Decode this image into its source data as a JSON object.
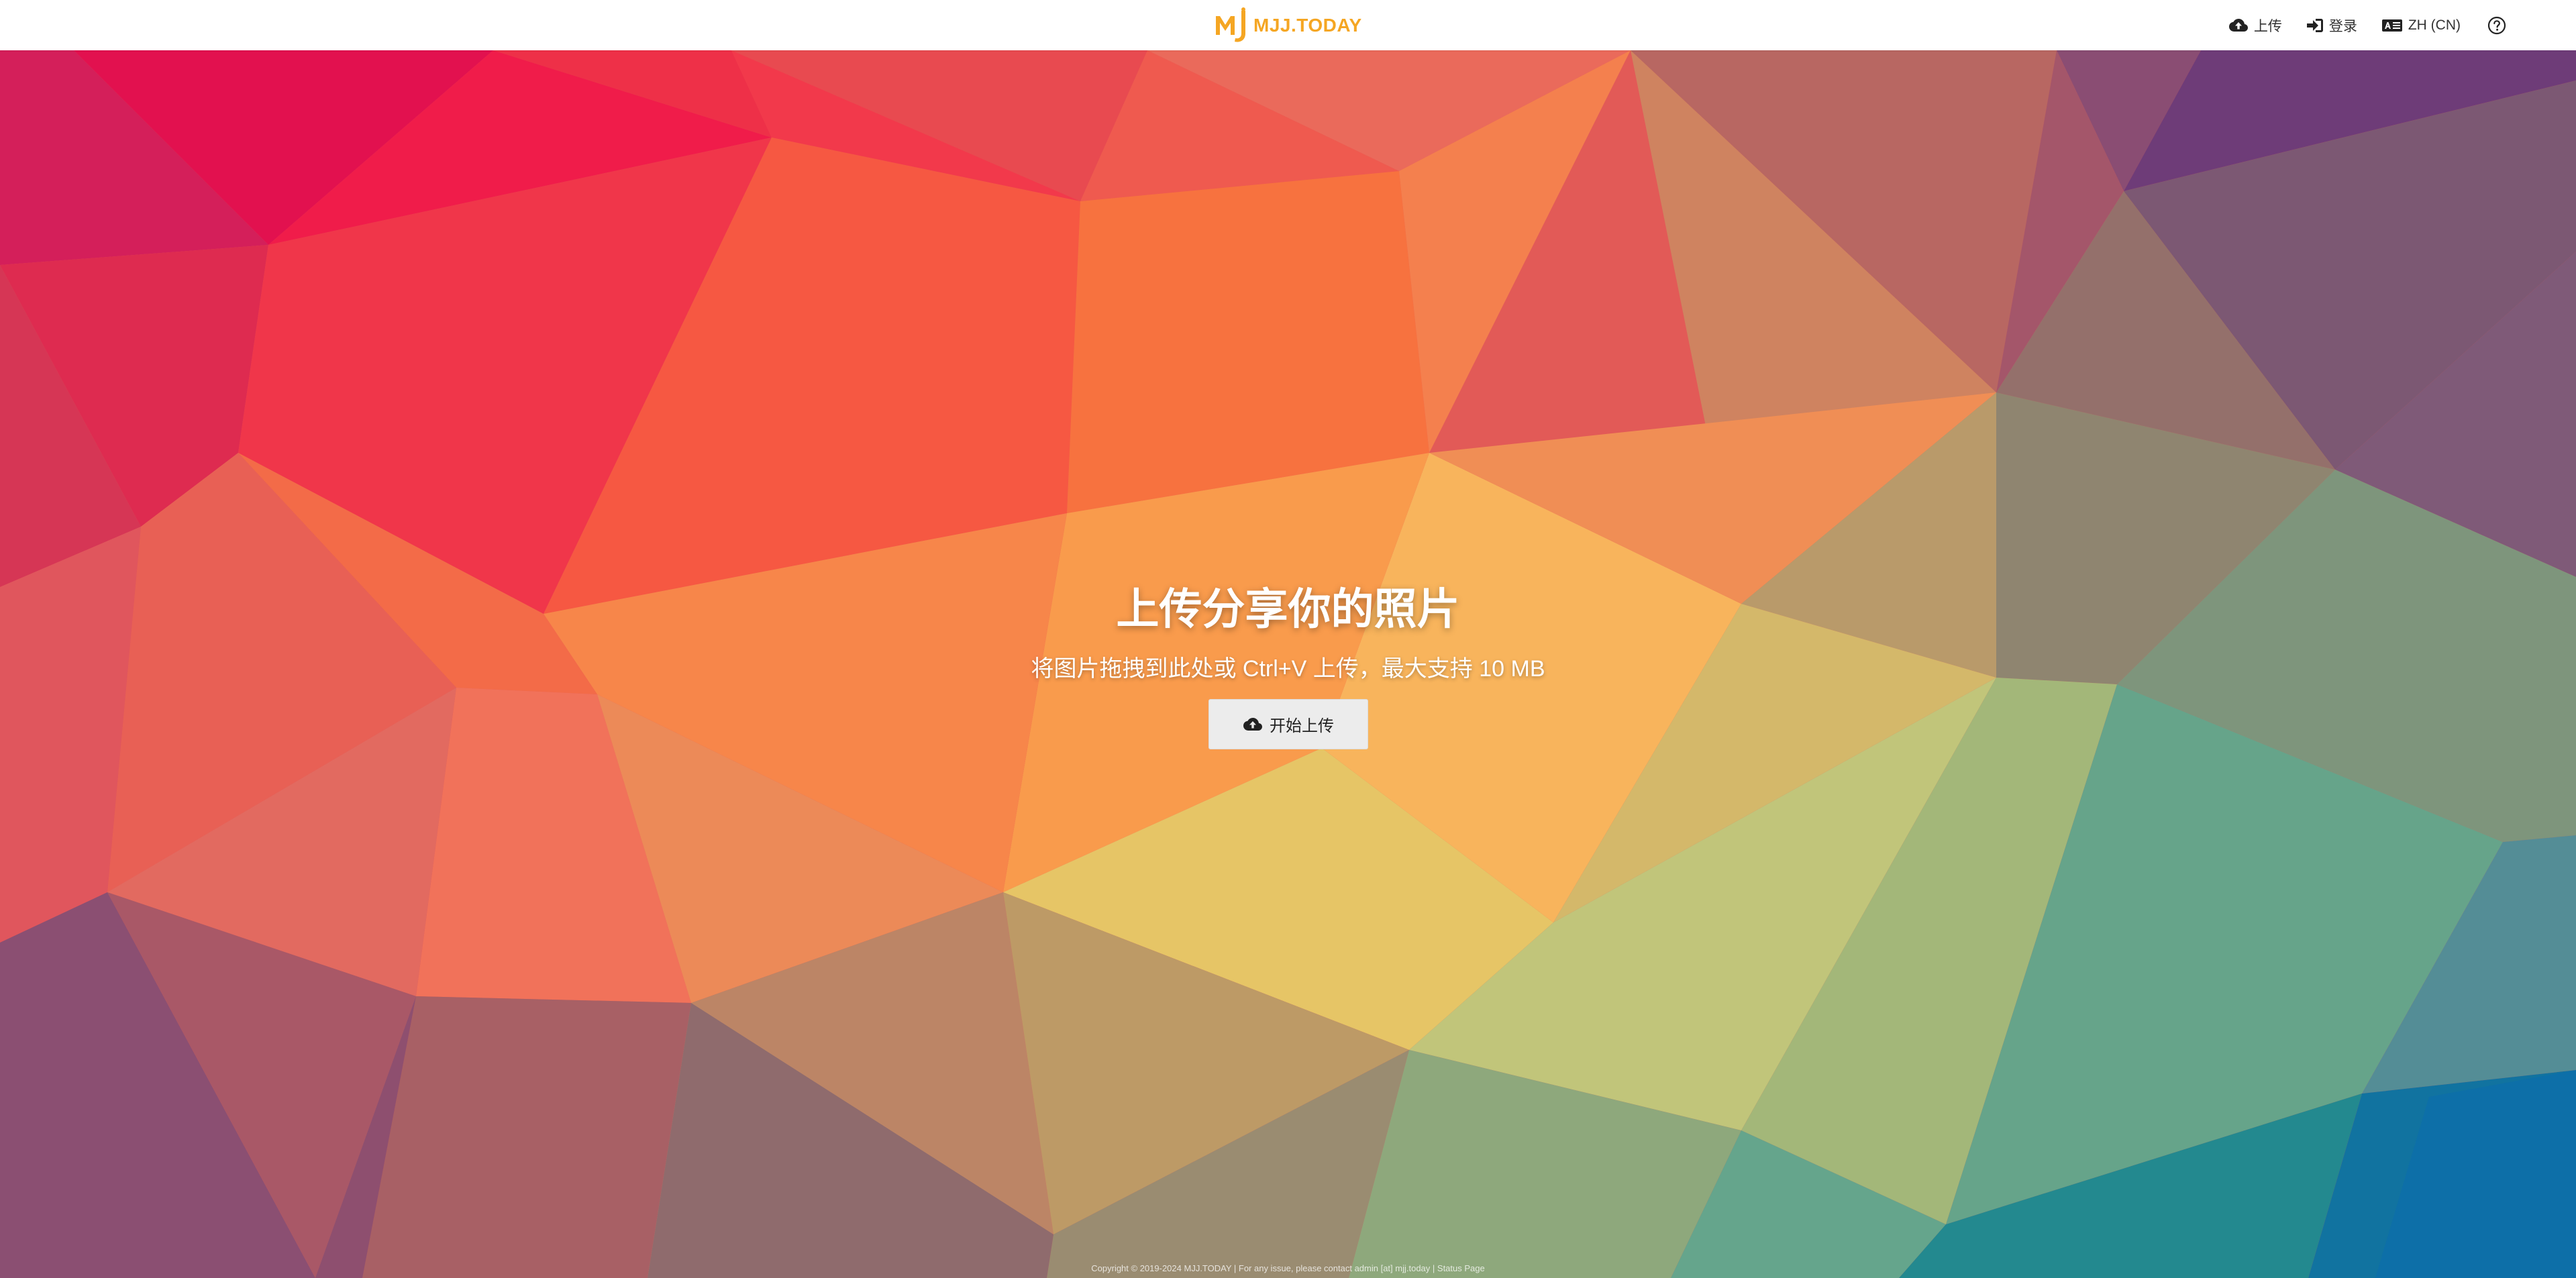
{
  "header": {
    "logo_text": "MJJ.TODAY",
    "logo_icon": "mj-logo-icon",
    "accent_color": "#f5a623",
    "nav": {
      "upload_label": "上传",
      "login_label": "登录",
      "language_label": "ZH (CN)",
      "help_icon": "question-circle-icon"
    }
  },
  "hero": {
    "title": "上传分享你的照片",
    "subtitle": "将图片拖拽到此处或 Ctrl+V 上传，最大支持 10 MB",
    "upload_button_label": "开始上传"
  },
  "footer": {
    "text": "Copyright © 2019-2024 MJJ.TODAY | For any issue, please contact admin [at] mjj.today | Status Page"
  }
}
